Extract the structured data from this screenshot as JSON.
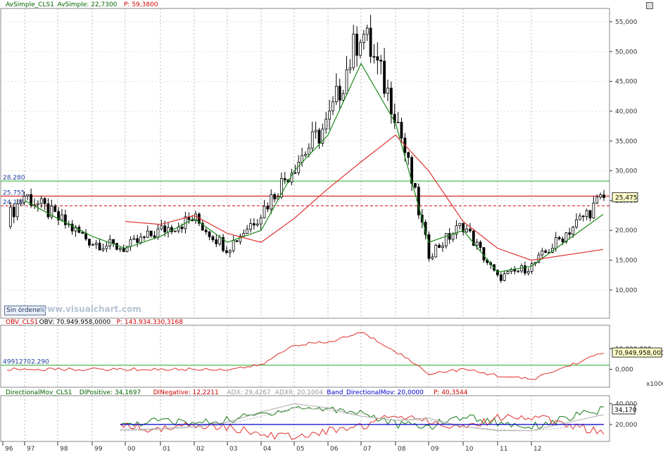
{
  "panels": {
    "price": {
      "header": [
        {
          "text": "AvSimple_CLS1",
          "color": "#006400"
        },
        {
          "text": "AvSimple: 22,7300",
          "color": "#006400"
        },
        {
          "text": "P: 59,3800",
          "color": "#d00000"
        }
      ],
      "yticks": [
        "55,000",
        "50,000",
        "45,000",
        "40,000",
        "35,000",
        "30,000",
        "25,000",
        "20,000",
        "15,000",
        "10,000"
      ],
      "levels": [
        {
          "label": "28.280",
          "color": "#22aa22"
        },
        {
          "label": "25.755",
          "color": "#d00000"
        },
        {
          "label": "24.135",
          "color": "#d00000"
        }
      ],
      "last_value": "25,475"
    },
    "obv": {
      "header": [
        {
          "text": "OBV_CLS1",
          "color": "#d00000"
        },
        {
          "text": "OBV: 70.949.958,0000",
          "color": "#000000"
        },
        {
          "text": "P: 143.934.330,3168",
          "color": "#d00000"
        }
      ],
      "yticks": [
        "10,000,000",
        "0,000"
      ],
      "level_label": "49912702.290",
      "last_value": "70,949,958,000",
      "scale_note": "x10000"
    },
    "dmi": {
      "header": [
        {
          "text": "DirectionalMov_CLS1",
          "color": "#006400"
        },
        {
          "text": "DIPositive: 34,1697",
          "color": "#006400"
        },
        {
          "text": "DINegative: 12,2211",
          "color": "#d00000"
        },
        {
          "text": "ADX: 29,4267",
          "color": "#999999"
        },
        {
          "text": "ADXR: 20,1004",
          "color": "#999999"
        },
        {
          "text": "Band_DirectionalMov: 20,0000",
          "color": "#0000cc"
        },
        {
          "text": "P: 40,3544",
          "color": "#d00000"
        }
      ],
      "yticks": [
        "40,000",
        "20,000"
      ],
      "last_value": "34,170"
    }
  },
  "xaxis_labels": [
    "96",
    "97",
    "98",
    "99",
    "00",
    "01",
    "02",
    "03",
    "04",
    "05",
    "06",
    "07",
    "08",
    "09",
    "10",
    "11",
    "12"
  ],
  "watermark": "www.visualchart.com",
  "orders_button": "Sin órdenes",
  "chart_data": [
    {
      "type": "candlestick",
      "title": "AvSimple_CLS1",
      "ylim": [
        5,
        57
      ],
      "x": [
        "1996",
        "1997",
        "1998",
        "1999",
        "2000",
        "2001",
        "2002",
        "2003",
        "2004",
        "2005",
        "2006",
        "2007",
        "2008",
        "2009",
        "2010",
        "2011",
        "2012",
        "2012-end"
      ],
      "series": [
        {
          "name": "price",
          "values": [
            21.0,
            26.0,
            22.0,
            18.0,
            17.0,
            20.0,
            22.0,
            17.0,
            23.0,
            31.0,
            38.0,
            54.0,
            40.0,
            16.0,
            21.0,
            12.0,
            14.0,
            25.5
          ]
        },
        {
          "name": "AvSimple",
          "values": [
            null,
            25.0,
            22.0,
            19.0,
            17.0,
            19.0,
            22.0,
            18.0,
            20.0,
            30.0,
            36.0,
            48.0,
            38.0,
            18.0,
            20.0,
            13.0,
            14.0,
            22.7
          ]
        },
        {
          "name": "P",
          "values": [
            null,
            null,
            null,
            null,
            21.5,
            21.0,
            22.5,
            19.5,
            18.0,
            22.0,
            27.0,
            31.5,
            36.0,
            30.0,
            21.5,
            17.0,
            15.0,
            16.8
          ]
        }
      ],
      "levels": [
        28.28,
        25.755,
        24.135
      ]
    },
    {
      "type": "line",
      "title": "OBV_CLS1",
      "series": [
        {
          "name": "OBV",
          "values": [
            0,
            0,
            0,
            0,
            0,
            0,
            0,
            0,
            2000000,
            12000000,
            13000000,
            18000000,
            9000000,
            -2000000,
            0,
            -3000000,
            -5000000,
            70949958
          ]
        }
      ]
    },
    {
      "type": "line",
      "title": "DirectionalMov_CLS1",
      "ylim": [
        5,
        45
      ],
      "series": [
        {
          "name": "DIPositive",
          "values": [
            null,
            null,
            null,
            null,
            20,
            24,
            21,
            24,
            30,
            36,
            35,
            32,
            20,
            18,
            28,
            22,
            18,
            34.17
          ]
        },
        {
          "name": "DINegative",
          "values": [
            null,
            null,
            null,
            null,
            18,
            15,
            20,
            18,
            10,
            8,
            14,
            18,
            30,
            24,
            16,
            26,
            28,
            12.22
          ]
        },
        {
          "name": "ADX",
          "values": [
            null,
            null,
            null,
            null,
            15,
            16,
            18,
            22,
            32,
            40,
            36,
            28,
            24,
            26,
            18,
            14,
            14,
            29.43
          ]
        },
        {
          "name": "ADXR",
          "values": [
            null,
            null,
            null,
            null,
            14,
            15,
            17,
            20,
            28,
            36,
            34,
            28,
            24,
            24,
            18,
            15,
            14,
            20.1
          ]
        },
        {
          "name": "Band_DirectionalMov",
          "values": [
            null,
            null,
            null,
            null,
            20,
            20,
            20,
            20,
            20,
            20,
            20,
            20,
            20,
            20,
            20,
            20,
            20,
            20
          ]
        }
      ]
    }
  ]
}
